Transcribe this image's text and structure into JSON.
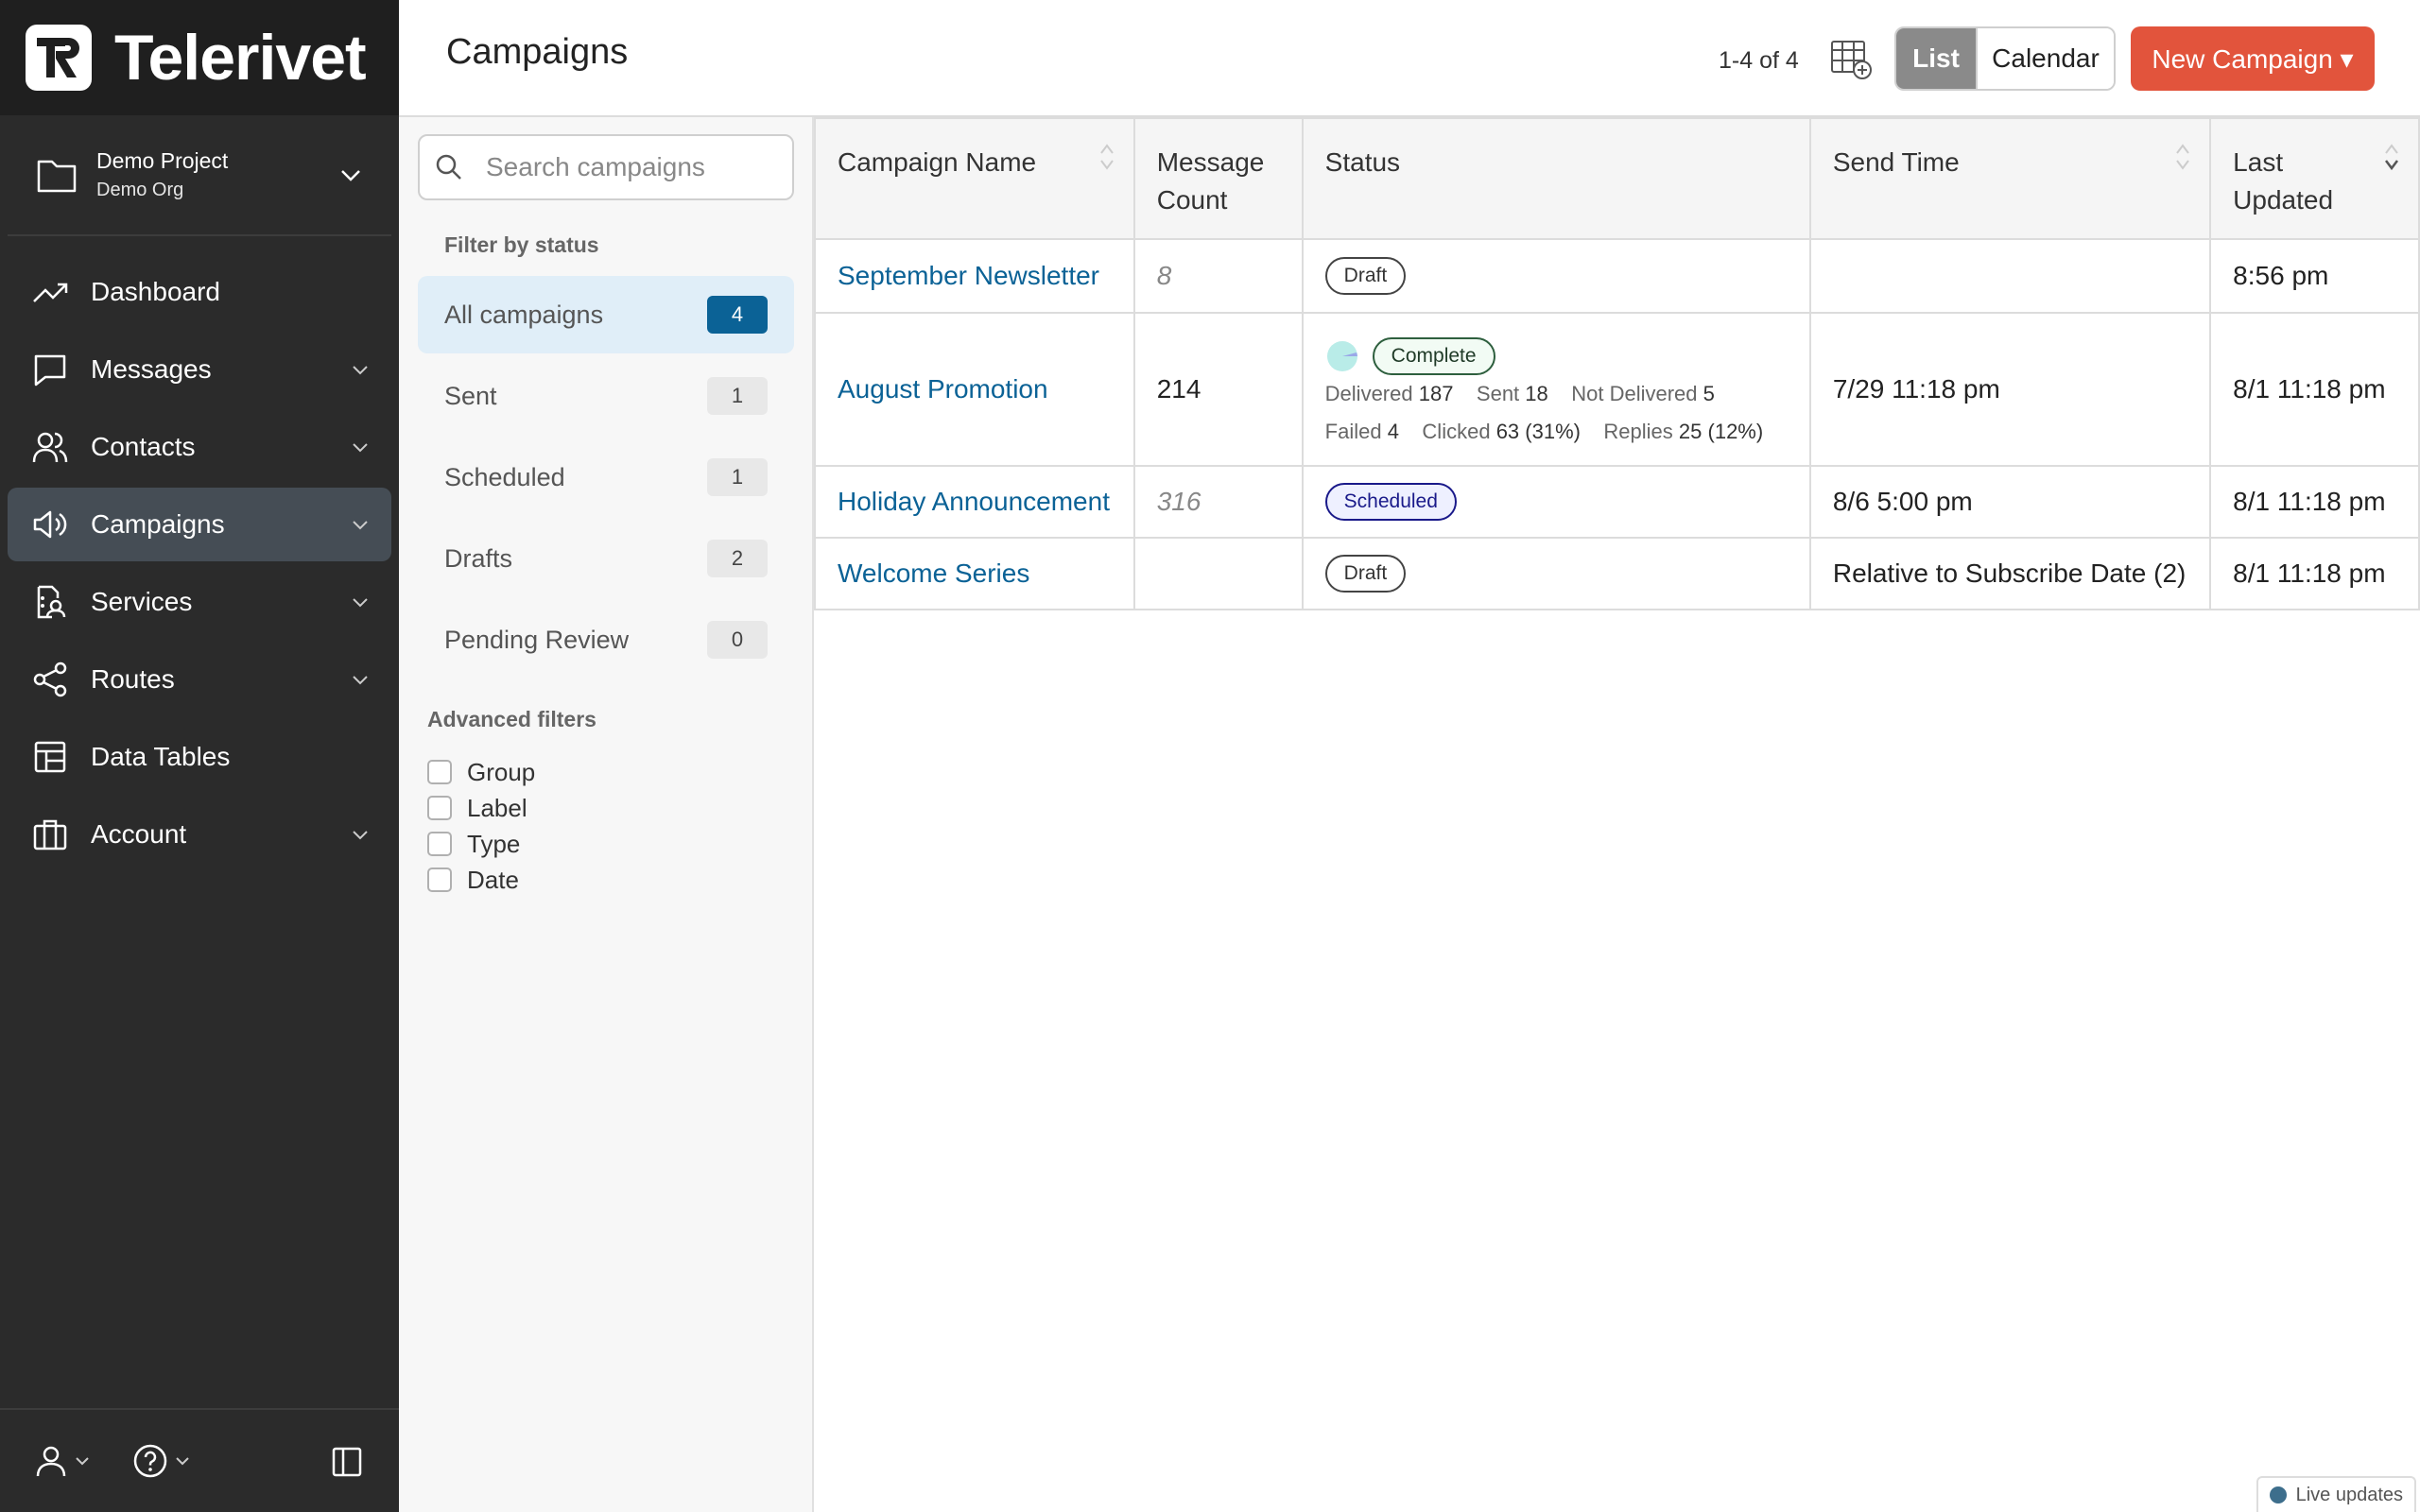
{
  "app": {
    "name": "Telerivet"
  },
  "project": {
    "name": "Demo Project",
    "org": "Demo Org"
  },
  "nav": [
    {
      "label": "Dashboard",
      "icon": "trend-icon",
      "has_chevron": false,
      "active": false
    },
    {
      "label": "Messages",
      "icon": "message-icon",
      "has_chevron": true,
      "active": false
    },
    {
      "label": "Contacts",
      "icon": "contacts-icon",
      "has_chevron": true,
      "active": false
    },
    {
      "label": "Campaigns",
      "icon": "megaphone-icon",
      "has_chevron": true,
      "active": true
    },
    {
      "label": "Services",
      "icon": "services-icon",
      "has_chevron": true,
      "active": false
    },
    {
      "label": "Routes",
      "icon": "routes-icon",
      "has_chevron": true,
      "active": false
    },
    {
      "label": "Data Tables",
      "icon": "table-icon",
      "has_chevron": false,
      "active": false
    },
    {
      "label": "Account",
      "icon": "briefcase-icon",
      "has_chevron": true,
      "active": false
    }
  ],
  "header": {
    "title": "Campaigns",
    "pager": "1-4 of 4",
    "view_list": "List",
    "view_calendar": "Calendar",
    "new_campaign": "New Campaign ▾"
  },
  "filters": {
    "search_placeholder": "Search campaigns",
    "status_heading": "Filter by status",
    "statuses": [
      {
        "label": "All campaigns",
        "count": "4",
        "active": true
      },
      {
        "label": "Sent",
        "count": "1",
        "active": false
      },
      {
        "label": "Scheduled",
        "count": "1",
        "active": false
      },
      {
        "label": "Drafts",
        "count": "2",
        "active": false
      },
      {
        "label": "Pending Review",
        "count": "0",
        "active": false
      }
    ],
    "advanced_heading": "Advanced filters",
    "advanced": [
      "Group",
      "Label",
      "Type",
      "Date"
    ]
  },
  "table": {
    "columns": [
      "Campaign Name",
      "Message Count",
      "Status",
      "Send Time",
      "Last Updated"
    ],
    "col_line1": [
      "Campaign Name",
      "Message",
      "Status",
      "Send Time",
      "Last"
    ],
    "col_line2": [
      "",
      "Count",
      "",
      "",
      "Updated"
    ],
    "rows": [
      {
        "name": "September Newsletter",
        "count": "8",
        "count_muted": true,
        "status": "Draft",
        "send_time": "",
        "updated": "8:56 pm"
      },
      {
        "name": "August Promotion",
        "count": "214",
        "count_muted": false,
        "status": "Complete",
        "send_time": "7/29 11:18 pm",
        "updated": "8/1 11:18 pm",
        "stats": {
          "delivered_label": "Delivered",
          "delivered": "187",
          "sent_label": "Sent",
          "sent": "18",
          "not_delivered_label": "Not Delivered",
          "not_delivered": "5",
          "failed_label": "Failed",
          "failed": "4",
          "clicked_label": "Clicked",
          "clicked": "63 (31%)",
          "replies_label": "Replies",
          "replies": "25 (12%)"
        }
      },
      {
        "name": "Holiday Announcement",
        "count": "316",
        "count_muted": true,
        "status": "Scheduled",
        "send_time": "8/6 5:00 pm",
        "updated": "8/1 11:18 pm"
      },
      {
        "name": "Welcome Series",
        "count": "",
        "count_muted": false,
        "status": "Draft",
        "send_time": "Relative to Subscribe Date (2)",
        "updated": "8/1 11:18 pm"
      }
    ]
  },
  "live_updates": "Live updates",
  "colors": {
    "accent": "#e2543c",
    "link": "#0b6296",
    "sidebar": "#2b2b2b"
  }
}
